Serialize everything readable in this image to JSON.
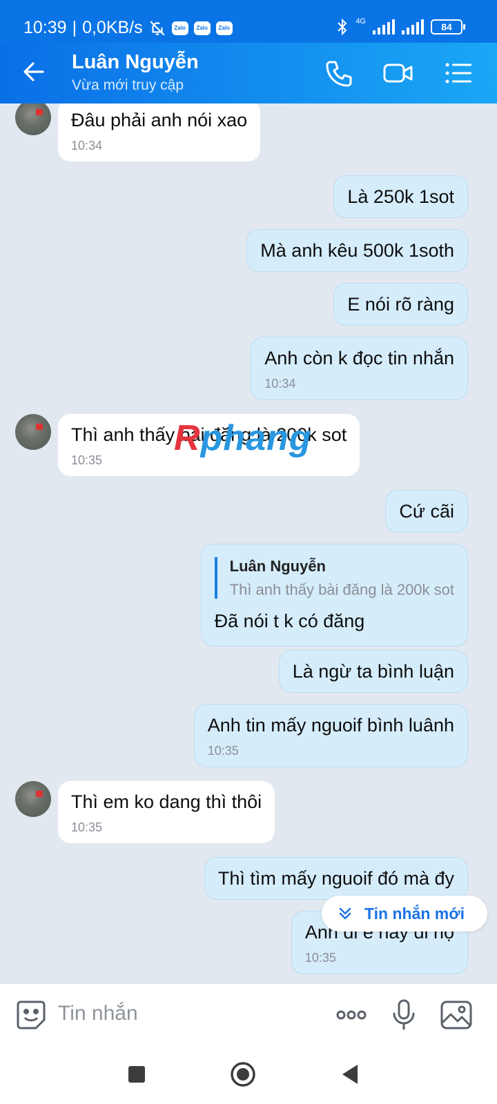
{
  "status_bar": {
    "time": "10:39",
    "speed": "0,0KB/s",
    "notif_labels": [
      "Zalo",
      "Zalo",
      "Zalo"
    ],
    "network": "4G",
    "battery": "84"
  },
  "header": {
    "name": "Luân Nguyễn",
    "status": "Vừa mới truy cập"
  },
  "messages": [
    {
      "dir": "in",
      "text": "Đâu phải anh nói xao",
      "time": "10:34"
    },
    {
      "dir": "out",
      "text": "Là 250k 1sot"
    },
    {
      "dir": "out",
      "text": "Mà anh kêu 500k 1soth"
    },
    {
      "dir": "out",
      "text": "E nói rõ ràng"
    },
    {
      "dir": "out",
      "text": "Anh còn k đọc tin nhắn",
      "time": "10:34"
    },
    {
      "dir": "in",
      "text": "Thì anh thấy bài đăng là 200k sot",
      "time": "10:35"
    },
    {
      "dir": "out",
      "text": "Cứ cãi"
    },
    {
      "dir": "out",
      "text": "Đã nói t k có đăng",
      "quote": {
        "name": "Luân Nguyễn",
        "text": "Thì anh thấy bài đăng là 200k sot"
      }
    },
    {
      "dir": "out",
      "text": "Là ngừ ta bình luận"
    },
    {
      "dir": "out",
      "text": "Anh tin mấy nguoif bình luânh",
      "time": "10:35"
    },
    {
      "dir": "in",
      "text": "Thì em ko dang thì thôi",
      "time": "10:35"
    },
    {
      "dir": "out",
      "text": "Thì tìm mấy nguoif đó mà đy"
    },
    {
      "dir": "out",
      "text": "Anh đi e nay đi nọ",
      "time": "10:35"
    }
  ],
  "watermark": {
    "part1": "R",
    "part2": "phang"
  },
  "new_message_button": "Tin nhắn mới",
  "input": {
    "placeholder": "Tin nhắn"
  },
  "colors": {
    "header": "#0a74e6",
    "outgoing_bubble": "#d5ecfb",
    "incoming_bubble": "#ffffff",
    "chat_bg": "#e2e8ef",
    "accent": "#1a73e8"
  }
}
